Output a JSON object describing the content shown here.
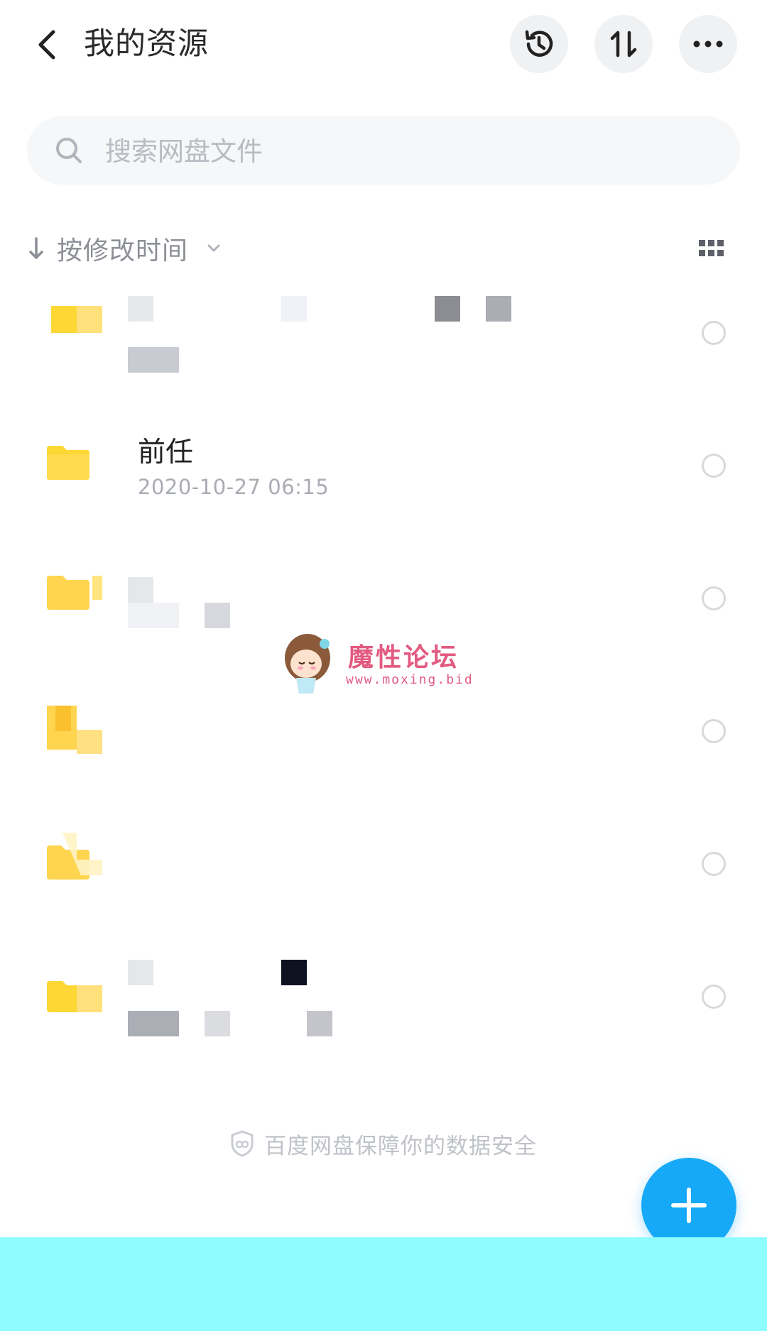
{
  "header": {
    "title": "我的资源",
    "icons": {
      "back": "chevron-left-icon",
      "history": "history-icon",
      "transfer": "transfer-icon",
      "more": "more-icon"
    }
  },
  "search": {
    "placeholder": "搜索网盘文件",
    "value": ""
  },
  "sort": {
    "label": "按修改时间",
    "direction": "descending"
  },
  "files": [
    {
      "name": "",
      "meta": "",
      "obscured": true
    },
    {
      "name": "前任",
      "meta": "2020-10-27   06:15",
      "obscured": false
    },
    {
      "name": "",
      "meta": "",
      "obscured": true
    },
    {
      "name": "",
      "meta": "",
      "obscured": true
    },
    {
      "name": "",
      "meta": "",
      "obscured": true
    },
    {
      "name": "",
      "meta": "",
      "obscured": true
    }
  ],
  "footer": {
    "notice": "百度网盘保障你的数据安全"
  },
  "watermark": {
    "title": "魔性论坛",
    "url": "www.moxing.bid"
  },
  "colors": {
    "accent": "#16a9f7",
    "folder": "#ffd54f",
    "bottom_bar": "#8efdff",
    "watermark": "#e25a80"
  }
}
